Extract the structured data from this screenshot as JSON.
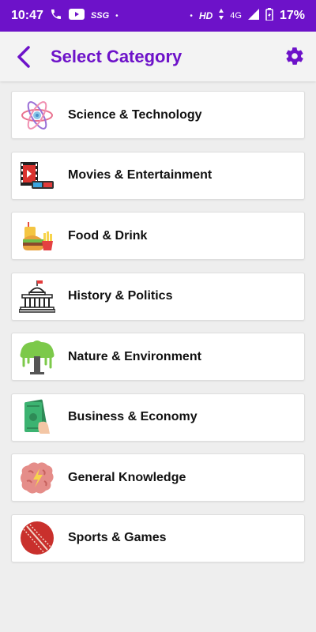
{
  "status_bar": {
    "time": "10:47",
    "carrier_tag": "SSG",
    "dot": "•",
    "hd": "HD",
    "network": "4G",
    "battery": "17%"
  },
  "app_bar": {
    "title": "Select Category"
  },
  "colors": {
    "accent": "#6d12c9",
    "background": "#eeeeee",
    "card": "#ffffff"
  },
  "categories": [
    {
      "label": "Science & Technology",
      "icon": "atom-icon"
    },
    {
      "label": "Movies & Entertainment",
      "icon": "film-3d-glasses-icon"
    },
    {
      "label": "Food & Drink",
      "icon": "burger-fries-drink-icon"
    },
    {
      "label": "History & Politics",
      "icon": "capitol-building-icon"
    },
    {
      "label": "Nature & Environment",
      "icon": "tree-icon"
    },
    {
      "label": "Business & Economy",
      "icon": "money-hand-icon"
    },
    {
      "label": "General Knowledge",
      "icon": "brain-icon"
    },
    {
      "label": "Sports & Games",
      "icon": "cricket-ball-icon"
    }
  ]
}
